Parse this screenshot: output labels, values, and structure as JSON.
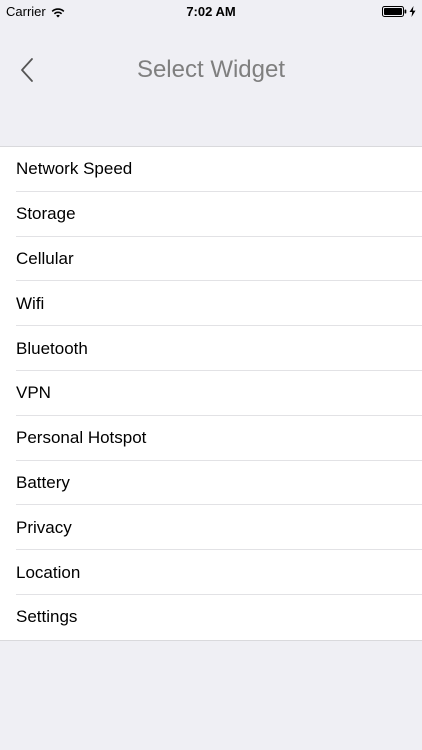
{
  "status_bar": {
    "carrier": "Carrier",
    "time": "7:02 AM"
  },
  "nav": {
    "title": "Select Widget"
  },
  "widgets": [
    {
      "label": "Network Speed"
    },
    {
      "label": "Storage"
    },
    {
      "label": "Cellular"
    },
    {
      "label": "Wifi"
    },
    {
      "label": "Bluetooth"
    },
    {
      "label": "VPN"
    },
    {
      "label": "Personal Hotspot"
    },
    {
      "label": "Battery"
    },
    {
      "label": "Privacy"
    },
    {
      "label": "Location"
    },
    {
      "label": "Settings"
    }
  ]
}
